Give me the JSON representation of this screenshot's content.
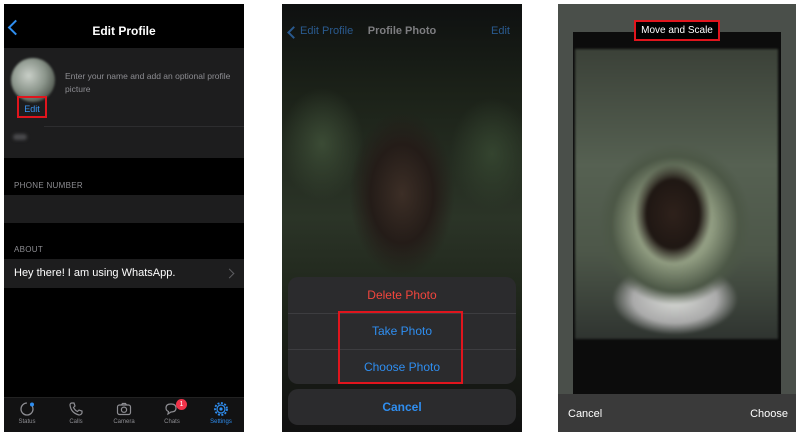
{
  "panel1": {
    "title": "Edit Profile",
    "profile_hint": "Enter your name and add an optional profile picture",
    "edit_label": "Edit",
    "phone_section_label": "PHONE NUMBER",
    "about_section_label": "ABOUT",
    "about_text": "Hey there! I am using WhatsApp.",
    "tabs": [
      {
        "label": "Status",
        "icon": "status-icon"
      },
      {
        "label": "Calls",
        "icon": "phone-icon"
      },
      {
        "label": "Camera",
        "icon": "camera-icon"
      },
      {
        "label": "Chats",
        "icon": "chat-bubbles-icon",
        "badge": "1"
      },
      {
        "label": "Settings",
        "icon": "gear-icon",
        "active": true
      }
    ]
  },
  "panel2": {
    "back_label": "Edit Profile",
    "title": "Profile Photo",
    "edit_label": "Edit",
    "delete_label": "Delete Photo",
    "take_label": "Take Photo",
    "choose_label": "Choose Photo",
    "cancel_label": "Cancel"
  },
  "panel3": {
    "title": "Move and Scale",
    "cancel_label": "Cancel",
    "choose_label": "Choose"
  },
  "colors": {
    "accent": "#2f8ef0",
    "destructive": "#f2453d",
    "highlight": "#e0151d",
    "badge": "#f2334a"
  }
}
